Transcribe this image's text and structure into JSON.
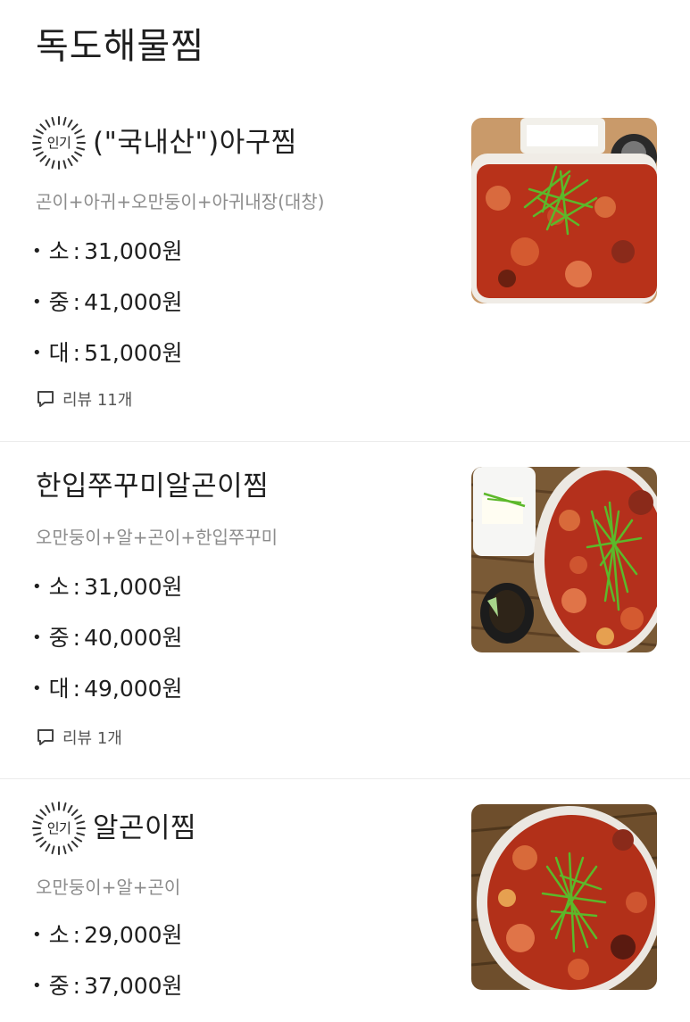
{
  "category": {
    "title": "독도해물찜"
  },
  "menu_items": [
    {
      "popular": true,
      "badge_label": "인기",
      "name": "(\"국내산\")아구찜",
      "description": "곤이+아귀+오만둥이+아귀내장(대창)",
      "prices": [
        {
          "size": "소",
          "price": "31,000원"
        },
        {
          "size": "중",
          "price": "41,000원"
        },
        {
          "size": "대",
          "price": "51,000원"
        }
      ],
      "review": "리뷰 11개",
      "image_icon": "braised-seafood-photo"
    },
    {
      "popular": false,
      "name": "한입쭈꾸미알곤이찜",
      "description": "오만둥이+알+곤이+한입쭈꾸미",
      "prices": [
        {
          "size": "소",
          "price": "31,000원"
        },
        {
          "size": "중",
          "price": "40,000원"
        },
        {
          "size": "대",
          "price": "49,000원"
        }
      ],
      "review": "리뷰 1개",
      "image_icon": "braised-seafood-photo"
    },
    {
      "popular": true,
      "badge_label": "인기",
      "name": "알곤이찜",
      "description": "오만둥이+알+곤이",
      "prices": [
        {
          "size": "소",
          "price": "29,000원"
        },
        {
          "size": "중",
          "price": "37,000원"
        }
      ],
      "image_icon": "braised-seafood-photo"
    }
  ],
  "ui": {
    "bullet": "•",
    "colon": ":",
    "colors": {
      "text": "#1f1f1f",
      "description": "#8c8c8c",
      "divider": "#ebebeb",
      "sauce_red": "#b8321a",
      "scallion_green": "#5cb82a"
    }
  }
}
